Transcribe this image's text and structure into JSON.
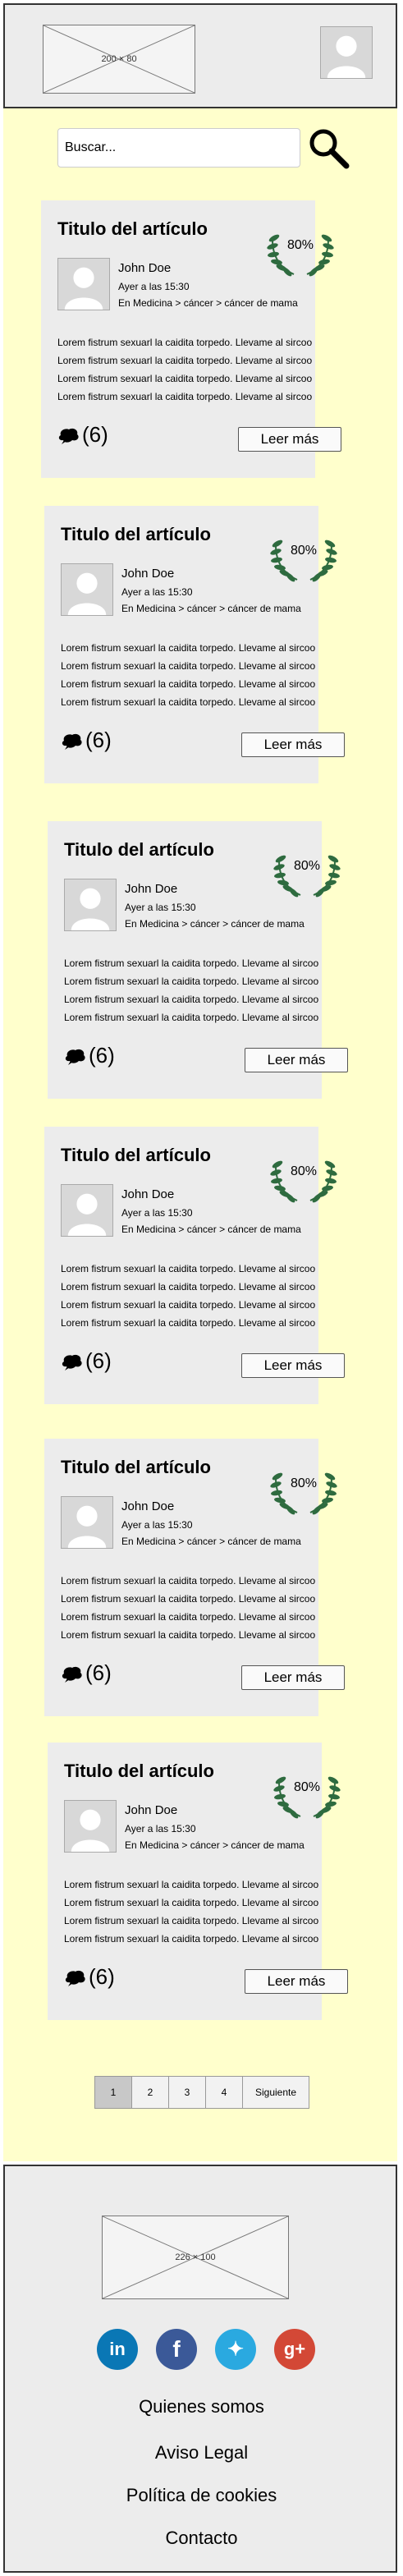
{
  "header": {
    "logo_text": "200 × 80"
  },
  "search": {
    "placeholder": "Buscar..."
  },
  "articles": [
    {
      "title": "Titulo del artículo",
      "rating": "80%",
      "author": "John Doe",
      "date": "Ayer a las 15:30",
      "crumb": "En Medicina > cáncer > cáncer de mama",
      "body": [
        "Lorem fistrum sexuarl la caidita torpedo. Llevame al sircoo",
        "Lorem fistrum sexuarl la caidita torpedo. Llevame al sircoo",
        "Lorem fistrum sexuarl la caidita torpedo. Llevame al sircoo",
        "Lorem fistrum sexuarl la caidita torpedo. Llevame al sircoo"
      ],
      "comments": "(6)",
      "read_more": "Leer más"
    },
    {
      "title": "Titulo del artículo",
      "rating": "80%",
      "author": "John Doe",
      "date": "Ayer a las 15:30",
      "crumb": "En Medicina > cáncer > cáncer de mama",
      "body": [
        "Lorem fistrum sexuarl la caidita torpedo. Llevame al sircoo",
        "Lorem fistrum sexuarl la caidita torpedo. Llevame al sircoo",
        "Lorem fistrum sexuarl la caidita torpedo. Llevame al sircoo",
        "Lorem fistrum sexuarl la caidita torpedo. Llevame al sircoo"
      ],
      "comments": "(6)",
      "read_more": "Leer más"
    },
    {
      "title": "Titulo del artículo",
      "rating": "80%",
      "author": "John Doe",
      "date": "Ayer a las 15:30",
      "crumb": "En Medicina > cáncer > cáncer de mama",
      "body": [
        "Lorem fistrum sexuarl la caidita torpedo. Llevame al sircoo",
        "Lorem fistrum sexuarl la caidita torpedo. Llevame al sircoo",
        "Lorem fistrum sexuarl la caidita torpedo. Llevame al sircoo",
        "Lorem fistrum sexuarl la caidita torpedo. Llevame al sircoo"
      ],
      "comments": "(6)",
      "read_more": "Leer más"
    },
    {
      "title": "Titulo del artículo",
      "rating": "80%",
      "author": "John Doe",
      "date": "Ayer a las 15:30",
      "crumb": "En Medicina > cáncer > cáncer de mama",
      "body": [
        "Lorem fistrum sexuarl la caidita torpedo. Llevame al sircoo",
        "Lorem fistrum sexuarl la caidita torpedo. Llevame al sircoo",
        "Lorem fistrum sexuarl la caidita torpedo. Llevame al sircoo",
        "Lorem fistrum sexuarl la caidita torpedo. Llevame al sircoo"
      ],
      "comments": "(6)",
      "read_more": "Leer más"
    },
    {
      "title": "Titulo del artículo",
      "rating": "80%",
      "author": "John Doe",
      "date": "Ayer a las 15:30",
      "crumb": "En Medicina > cáncer > cáncer de mama",
      "body": [
        "Lorem fistrum sexuarl la caidita torpedo. Llevame al sircoo",
        "Lorem fistrum sexuarl la caidita torpedo. Llevame al sircoo",
        "Lorem fistrum sexuarl la caidita torpedo. Llevame al sircoo",
        "Lorem fistrum sexuarl la caidita torpedo. Llevame al sircoo"
      ],
      "comments": "(6)",
      "read_more": "Leer más"
    },
    {
      "title": "Titulo del artículo",
      "rating": "80%",
      "author": "John Doe",
      "date": "Ayer a las 15:30",
      "crumb": "En Medicina > cáncer > cáncer de mama",
      "body": [
        "Lorem fistrum sexuarl la caidita torpedo. Llevame al sircoo",
        "Lorem fistrum sexuarl la caidita torpedo. Llevame al sircoo",
        "Lorem fistrum sexuarl la caidita torpedo. Llevame al sircoo",
        "Lorem fistrum sexuarl la caidita torpedo. Llevame al sircoo"
      ],
      "comments": "(6)",
      "read_more": "Leer más"
    }
  ],
  "pagination": {
    "pages": [
      "1",
      "2",
      "3",
      "4"
    ],
    "active": "1",
    "next_label": "Siguiente"
  },
  "footer": {
    "logo_text": "226 × 100",
    "social": [
      {
        "icon": "linkedin-icon",
        "glyph": "in",
        "color": "#0a77b5"
      },
      {
        "icon": "facebook-icon",
        "glyph": "f",
        "color": "#3b5998"
      },
      {
        "icon": "twitter-icon",
        "glyph": "✦",
        "color": "#2aa9e0"
      },
      {
        "icon": "googleplus-icon",
        "glyph": "g+",
        "color": "#d34836"
      }
    ],
    "links": [
      "Quienes somos",
      "Aviso Legal",
      "Política de cookies",
      "Contacto"
    ]
  },
  "colors": {
    "main_bg": "#ffffcc",
    "card_bg": "#ececec",
    "laurel": "#2e6b3f"
  }
}
